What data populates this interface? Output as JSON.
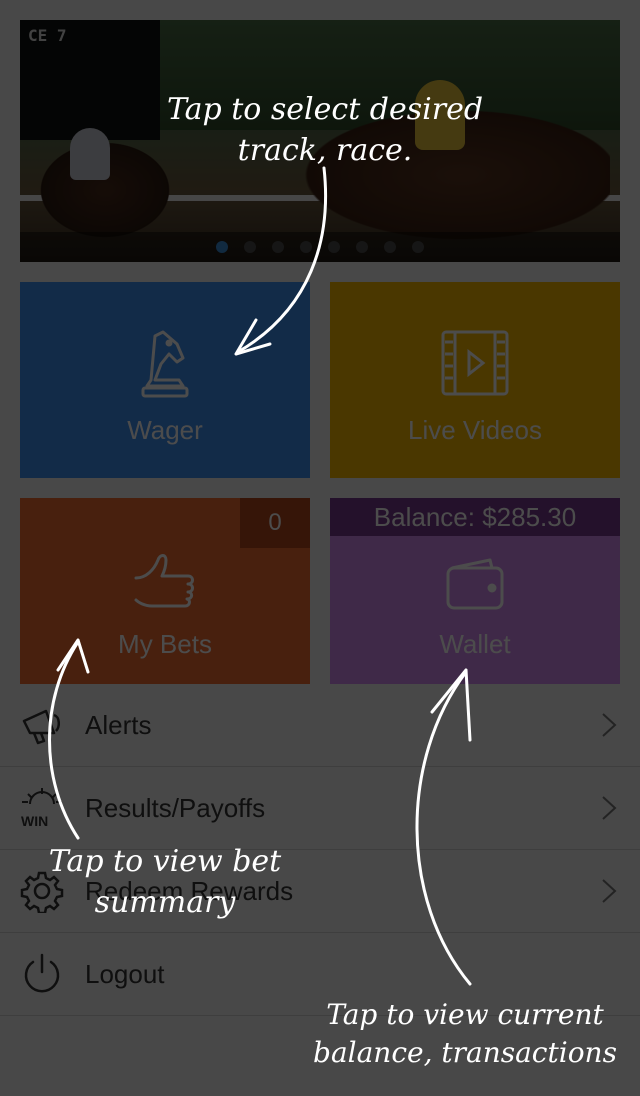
{
  "banner": {
    "scoreboard_text": "CE 7",
    "slide_count": 8,
    "active_slide": 1
  },
  "tiles": {
    "wager": {
      "label": "Wager",
      "color": "#3f8ff2"
    },
    "live_videos": {
      "label": "Live Videos",
      "color": "#f7b801"
    },
    "my_bets": {
      "label": "My Bets",
      "badge": "0",
      "color": "#f26b30"
    },
    "wallet": {
      "label": "Wallet",
      "balance": "Balance: $285.30",
      "color": "#d38af0"
    }
  },
  "menu": {
    "items": [
      {
        "label": "Alerts",
        "icon": "megaphone-icon"
      },
      {
        "label": "Results/Payoffs",
        "icon": "win-icon",
        "icon_text": "WIN"
      },
      {
        "label": "Redeem Rewards",
        "icon": "gear-icon"
      },
      {
        "label": "Logout",
        "icon": "power-icon"
      }
    ]
  },
  "annotations": {
    "track": "Tap to select desired track, race.",
    "bets": "Tap to view bet summary",
    "wallet": "Tap to view current balance, transactions"
  }
}
